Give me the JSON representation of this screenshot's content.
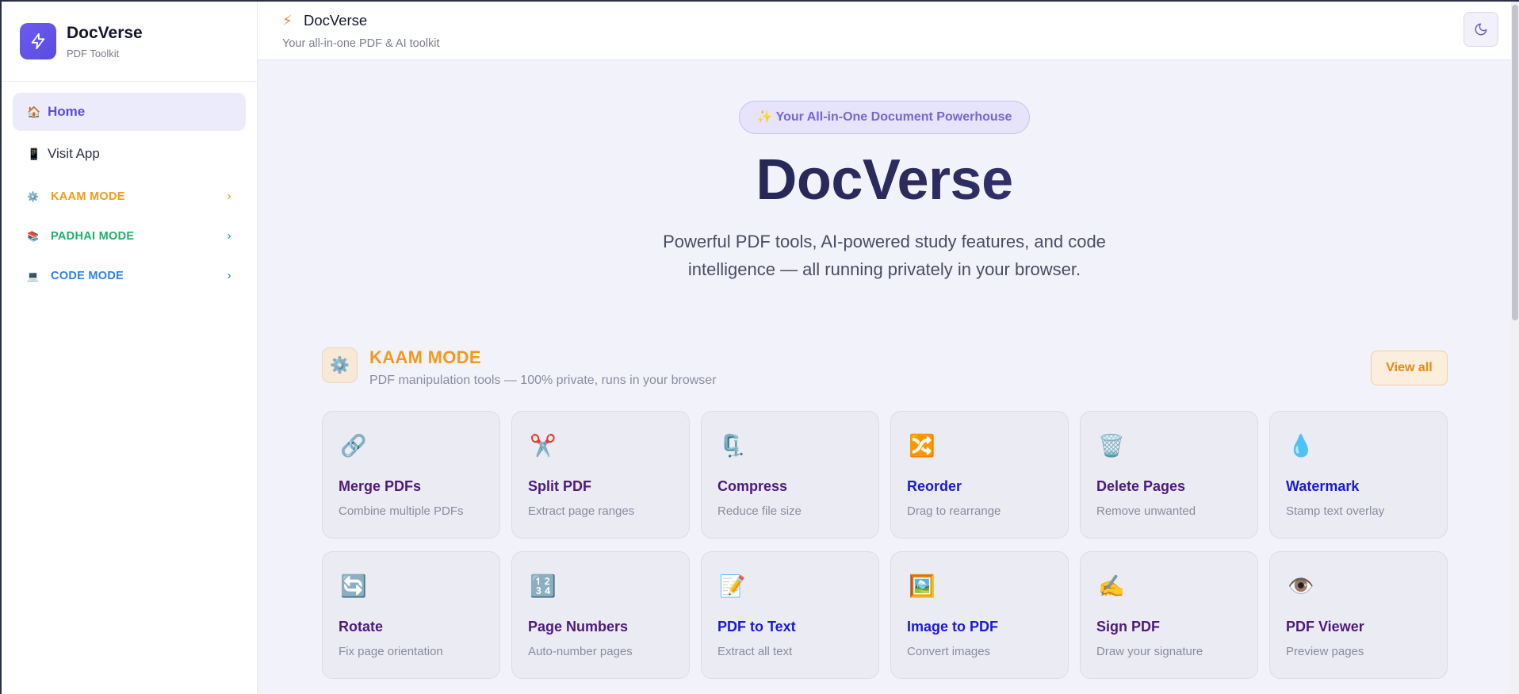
{
  "brand": {
    "title": "DocVerse",
    "subtitle": "PDF Toolkit"
  },
  "sidebar": {
    "nav": [
      {
        "icon": "🏠",
        "label": "Home",
        "active": true
      },
      {
        "icon": "📱",
        "label": "Visit App",
        "active": false
      }
    ],
    "modes": [
      {
        "icon": "⚙️",
        "label": "KAAM MODE",
        "color": "#f39a1a"
      },
      {
        "icon": "📚",
        "label": "PADHAI MODE",
        "color": "#1fae6e"
      },
      {
        "icon": "💻",
        "label": "CODE MODE",
        "color": "#2f7fe0"
      }
    ]
  },
  "topbar": {
    "icon": "⚡",
    "title": "DocVerse",
    "subtitle": "Your all-in-one PDF & AI toolkit"
  },
  "hero": {
    "pill": "✨ Your All-in-One Document Powerhouse",
    "title": "DocVerse",
    "description": "Powerful PDF tools, AI-powered study features, and code intelligence — all running privately in your browser."
  },
  "section": {
    "icon": "⚙️",
    "title": "KAAM MODE",
    "subtitle": "PDF manipulation tools — 100% private, runs in your browser",
    "view_all": "View all",
    "tools": [
      {
        "icon": "🔗",
        "title": "Merge PDFs",
        "desc": "Combine multiple PDFs",
        "tone": "purple"
      },
      {
        "icon": "✂️",
        "title": "Split PDF",
        "desc": "Extract page ranges",
        "tone": "purple"
      },
      {
        "icon": "🗜️",
        "title": "Compress",
        "desc": "Reduce file size",
        "tone": "purple"
      },
      {
        "icon": "🔀",
        "title": "Reorder",
        "desc": "Drag to rearrange",
        "tone": "blue"
      },
      {
        "icon": "🗑️",
        "title": "Delete Pages",
        "desc": "Remove unwanted",
        "tone": "purple"
      },
      {
        "icon": "💧",
        "title": "Watermark",
        "desc": "Stamp text overlay",
        "tone": "blue"
      },
      {
        "icon": "🔄",
        "title": "Rotate",
        "desc": "Fix page orientation",
        "tone": "purple"
      },
      {
        "icon": "🔢",
        "title": "Page Numbers",
        "desc": "Auto-number pages",
        "tone": "purple"
      },
      {
        "icon": "📝",
        "title": "PDF to Text",
        "desc": "Extract all text",
        "tone": "blue"
      },
      {
        "icon": "🖼️",
        "title": "Image to PDF",
        "desc": "Convert images",
        "tone": "blue"
      },
      {
        "icon": "✍️",
        "title": "Sign PDF",
        "desc": "Draw your signature",
        "tone": "purple"
      },
      {
        "icon": "👁️",
        "title": "PDF Viewer",
        "desc": "Preview pages",
        "tone": "purple"
      }
    ]
  }
}
